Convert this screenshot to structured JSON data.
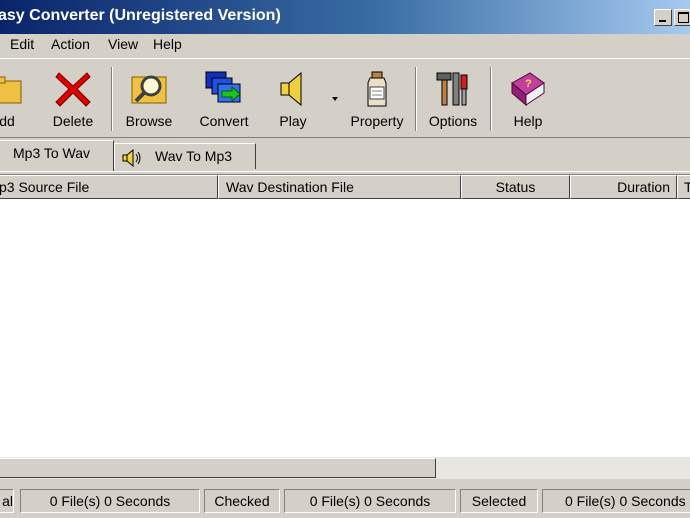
{
  "window": {
    "title": "asy Converter  (Unregistered Version)"
  },
  "menu": [
    "Edit",
    "Action",
    "View",
    "Help"
  ],
  "toolbar": [
    {
      "label": "dd",
      "icon": "add-folder-icon"
    },
    {
      "label": "Delete",
      "icon": "delete-x-icon"
    },
    {
      "label": "Browse",
      "icon": "browse-magnifier-icon"
    },
    {
      "label": "Convert",
      "icon": "convert-windows-icon"
    },
    {
      "label": "Play",
      "icon": "speaker-icon"
    },
    {
      "label": "Property",
      "icon": "property-bottle-icon"
    },
    {
      "label": "Options",
      "icon": "tools-icon"
    },
    {
      "label": "Help",
      "icon": "help-book-icon"
    }
  ],
  "tabs": [
    {
      "label": "Mp3 To Wav",
      "active": true
    },
    {
      "label": "Wav To Mp3",
      "active": false
    }
  ],
  "columns": [
    "p3 Source File",
    "Wav Destination File",
    "Status",
    "Duration",
    "T"
  ],
  "statusbar": {
    "total_label": "al",
    "total_value": "0 File(s)  0 Seconds",
    "checked_label": "Checked",
    "checked_value": "0 File(s)  0 Seconds",
    "selected_label": "Selected",
    "selected_value": "0 File(s)  0 Seconds"
  }
}
